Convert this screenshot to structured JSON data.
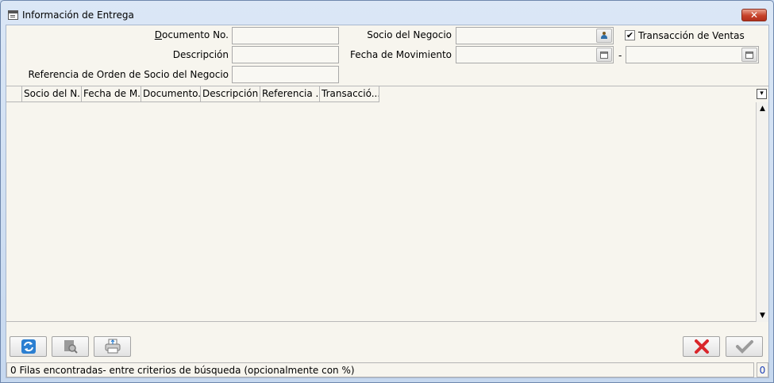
{
  "window": {
    "title": "Información de Entrega",
    "close_label": "✕"
  },
  "form": {
    "documento_label": "Documento No.",
    "documento_underline": "D",
    "documento_rest": "ocumento No.",
    "documento_value": "",
    "descripcion_label": "Descripción",
    "descripcion_value": "",
    "referencia_label": "Referencia de Orden de Socio del Negocio",
    "referencia_value": "",
    "socio_label": "Socio del Negocio",
    "socio_value": "",
    "fecha_label": "Fecha de Movimiento",
    "fecha_from": "",
    "fecha_separator": "-",
    "fecha_to": "",
    "transaccion_label": "Transacción de Ventas",
    "transaccion_checked": "✔"
  },
  "grid": {
    "columns": [
      "",
      "Socio del N...",
      "Fecha de M...",
      "Documento...",
      "Descripción",
      "Referencia ...",
      "Transacció..."
    ],
    "rows": []
  },
  "toolbar": {
    "refresh": "refresh-icon",
    "zoom": "zoom-icon",
    "print": "print-icon",
    "cancel": "cancel-icon",
    "ok": "ok-icon"
  },
  "status": {
    "text": "0 Filas encontradas- entre criterios de búsqueda (opcionalmente con %)",
    "count": "0"
  },
  "colors": {
    "accent": "#c7422a",
    "cancel": "#d9262b",
    "ok": "#9b9b9b",
    "refresh": "#2b7fd1"
  }
}
